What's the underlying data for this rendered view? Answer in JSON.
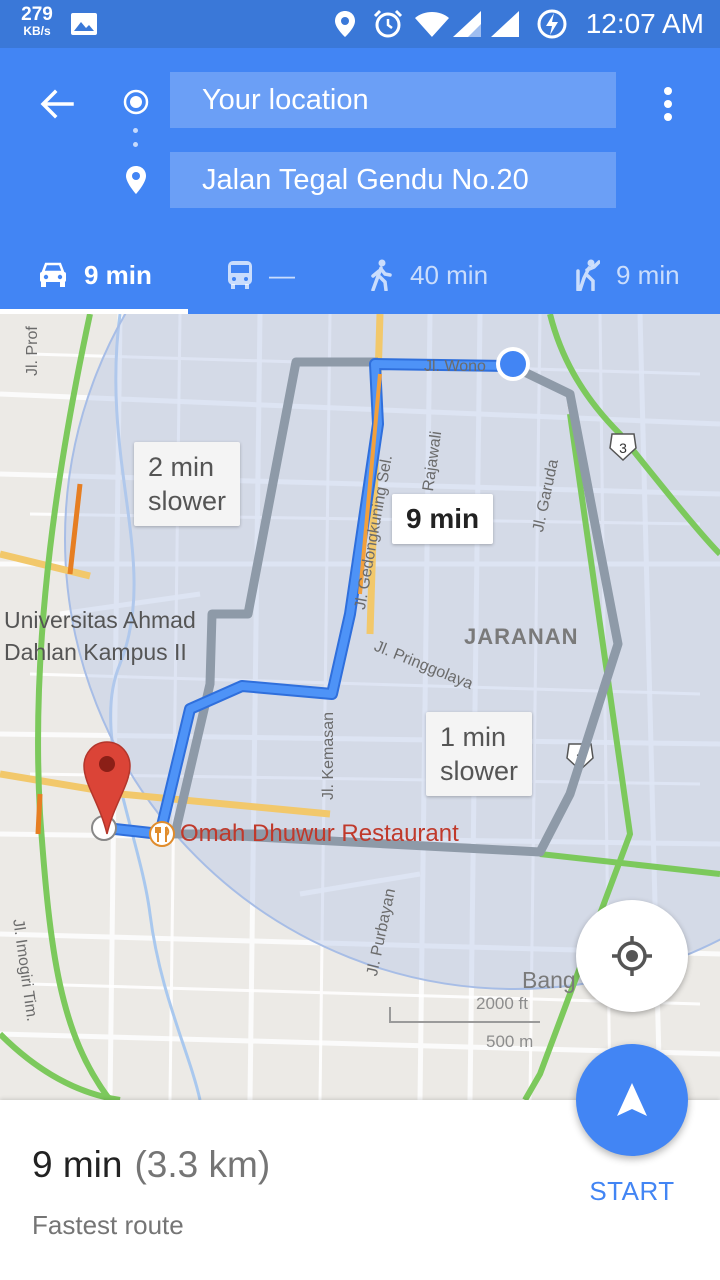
{
  "status_bar": {
    "net_speed": "279",
    "net_unit": "KB/s",
    "time": "12:07 AM",
    "icons": [
      "image-icon",
      "location-icon",
      "alarm-icon",
      "wifi-icon",
      "signal-icon",
      "battery-charging-icon"
    ]
  },
  "header": {
    "origin": "Your location",
    "destination": "Jalan Tegal Gendu No.20",
    "modes": [
      {
        "icon": "car-icon",
        "label": "9 min",
        "active": true
      },
      {
        "icon": "transit-icon",
        "label": "—",
        "active": false
      },
      {
        "icon": "walk-icon",
        "label": "40 min",
        "active": false
      },
      {
        "icon": "ride-icon",
        "label": "9 min",
        "active": false
      }
    ],
    "accent_color": "#4285f4"
  },
  "map": {
    "callouts": {
      "alt1": "2 min\nslower",
      "main": "9 min",
      "alt2": "1 min\nslower"
    },
    "streets": {
      "prof": "Jl. Prof",
      "wono": "Jl. Wono",
      "rajawali": "Rajawali",
      "gedong": "Jl. Gedongkuning Sel.",
      "garuda": "Jl. Garuda",
      "pringgo": "Jl. Pringgolaya",
      "kemasan": "Jl. Kemasan",
      "purbayan": "Jl. Purbayan",
      "imogiri": "Jl. Imogiri Tim."
    },
    "places": {
      "university": "Universitas Ahmad\nDahlan Kampus II",
      "area": "JARANAN",
      "restaurant": "Omah Dhuwur Restaurant",
      "bang": "Bang"
    },
    "highway_badges": [
      "3",
      "3"
    ],
    "scale": {
      "ft": "2000 ft",
      "m": "500 m"
    }
  },
  "route_summary": {
    "time": "9 min",
    "distance": "(3.3 km)",
    "description": "Fastest route"
  },
  "start_label": "START"
}
